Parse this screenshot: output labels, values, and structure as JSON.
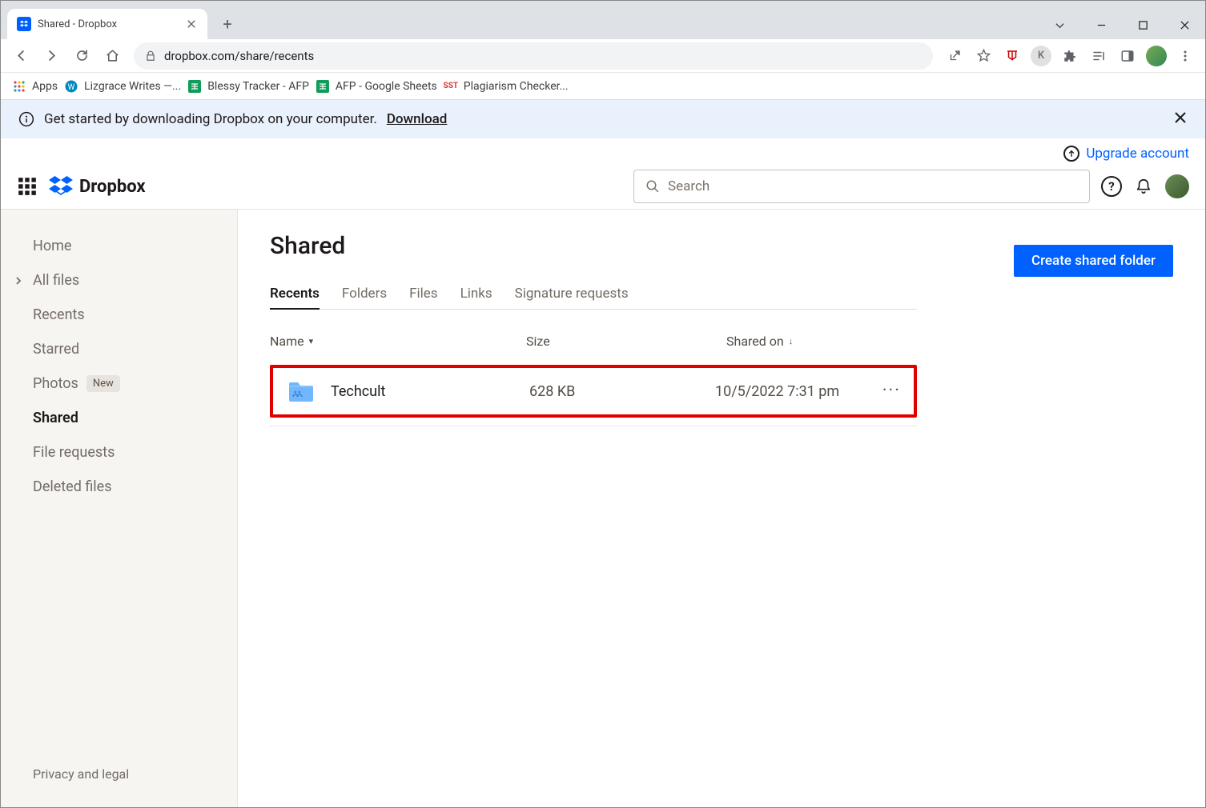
{
  "browser": {
    "tab_title": "Shared - Dropbox",
    "url": "dropbox.com/share/recents",
    "bookmarks": [
      {
        "label": "Apps"
      },
      {
        "label": "Lizgrace Writes —..."
      },
      {
        "label": "Blessy Tracker - AFP"
      },
      {
        "label": "AFP - Google Sheets"
      },
      {
        "label": "Plagiarism Checker..."
      }
    ]
  },
  "notice": {
    "text": "Get started by downloading Dropbox on your computer.",
    "cta": "Download"
  },
  "upgrade_label": "Upgrade account",
  "logo_word": "Dropbox",
  "search": {
    "placeholder": "Search"
  },
  "sidebar": {
    "items": [
      {
        "label": "Home"
      },
      {
        "label": "All files",
        "has_chevron": true
      },
      {
        "label": "Recents"
      },
      {
        "label": "Starred"
      },
      {
        "label": "Photos",
        "badge": "New"
      },
      {
        "label": "Shared",
        "active": true
      },
      {
        "label": "File requests"
      },
      {
        "label": "Deleted files"
      }
    ],
    "footer": "Privacy and legal"
  },
  "main": {
    "title": "Shared",
    "tabs": [
      "Recents",
      "Folders",
      "Files",
      "Links",
      "Signature requests"
    ],
    "active_tab": 0,
    "create_button": "Create shared folder",
    "columns": {
      "name": "Name",
      "size": "Size",
      "shared": "Shared on"
    },
    "rows": [
      {
        "name": "Techcult",
        "size": "628 KB",
        "shared": "10/5/2022 7:31 pm"
      }
    ]
  }
}
